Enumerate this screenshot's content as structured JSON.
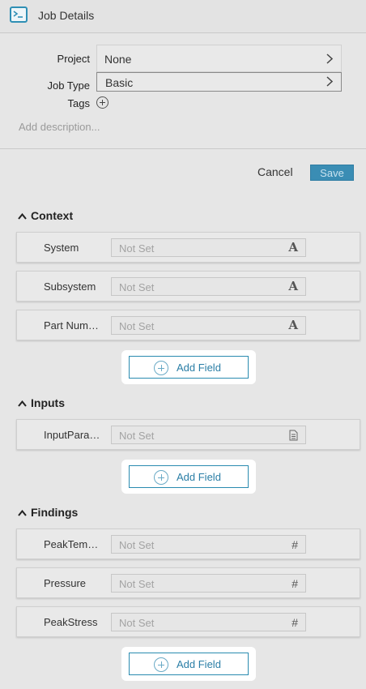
{
  "header": {
    "title": "Job Details",
    "icon": "terminal-icon"
  },
  "form": {
    "project_label": "Project",
    "project_value": "None",
    "job_type_label": "Job Type",
    "job_type_value": "Basic",
    "tags_label": "Tags",
    "description_placeholder": "Add description..."
  },
  "actions": {
    "cancel": "Cancel",
    "save": "Save"
  },
  "sections": [
    {
      "title": "Context",
      "fields": [
        {
          "name": "System",
          "placeholder": "Not Set",
          "type_icon": "A"
        },
        {
          "name": "Subsystem",
          "placeholder": "Not Set",
          "type_icon": "A"
        },
        {
          "name": "Part Number",
          "placeholder": "Not Set",
          "type_icon": "A"
        }
      ],
      "add_label": "Add Field"
    },
    {
      "title": "Inputs",
      "fields": [
        {
          "name": "InputParameters",
          "placeholder": "Not Set",
          "type_icon": "document"
        }
      ],
      "add_label": "Add Field"
    },
    {
      "title": "Findings",
      "fields": [
        {
          "name": "PeakTemperature",
          "placeholder": "Not Set",
          "type_icon": "#"
        },
        {
          "name": "Pressure",
          "placeholder": "Not Set",
          "type_icon": "#"
        },
        {
          "name": "PeakStress",
          "placeholder": "Not Set",
          "type_icon": "#"
        }
      ],
      "add_label": "Add Field"
    }
  ],
  "colors": {
    "accent": "#2a8bb0",
    "save_bg": "#3a8db4"
  }
}
